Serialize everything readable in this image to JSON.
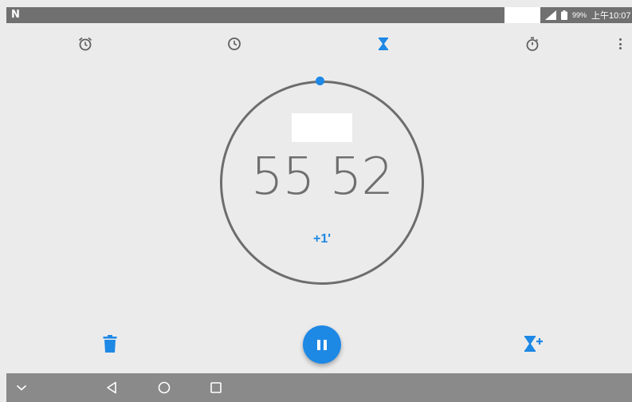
{
  "status_bar": {
    "notification_glyph": "N",
    "battery_percent": "99%",
    "time": "上午10:07",
    "icons": [
      "signal-icon",
      "battery-icon"
    ]
  },
  "tabs": [
    {
      "icon": "alarm-icon",
      "active": false
    },
    {
      "icon": "clock-icon",
      "active": false
    },
    {
      "icon": "hourglass-icon",
      "active": true
    },
    {
      "icon": "stopwatch-icon",
      "active": false
    }
  ],
  "timer": {
    "label": "",
    "time": "55 52",
    "add_minute": "+1'"
  },
  "colors": {
    "accent": "#1e88e5",
    "ring": "#6d6d6d",
    "background": "#ebebeb",
    "icon_inactive": "#606060"
  },
  "nav_bar": {
    "icons": [
      "chevron-down-icon",
      "back-icon",
      "home-icon",
      "recents-icon"
    ]
  }
}
